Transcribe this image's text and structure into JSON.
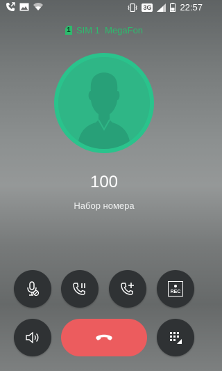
{
  "status_bar": {
    "time": "22:57",
    "network_type": "3G",
    "left_icons": [
      "call-forward-icon",
      "image-icon",
      "wifi-icon"
    ],
    "right_icons": [
      "vibrate-icon",
      "network-badge",
      "signal-icon",
      "battery-icon"
    ]
  },
  "sim": {
    "slot": "1",
    "label": "SIM 1  MegaFon",
    "color": "#2dbb6d"
  },
  "avatar": {
    "icon": "person-silhouette-icon",
    "color": "#2fb686"
  },
  "call": {
    "number": "100",
    "status": "Набор номера"
  },
  "controls": {
    "row1": [
      "mute-mic-icon",
      "hold-call-icon",
      "add-call-icon",
      "record-icon"
    ],
    "record_label": "REC",
    "row2": [
      "speaker-icon",
      "end-call-icon",
      "dialpad-icon"
    ]
  },
  "colors": {
    "end_call": "#ec5c5e",
    "button_bg": "#2f3234"
  }
}
